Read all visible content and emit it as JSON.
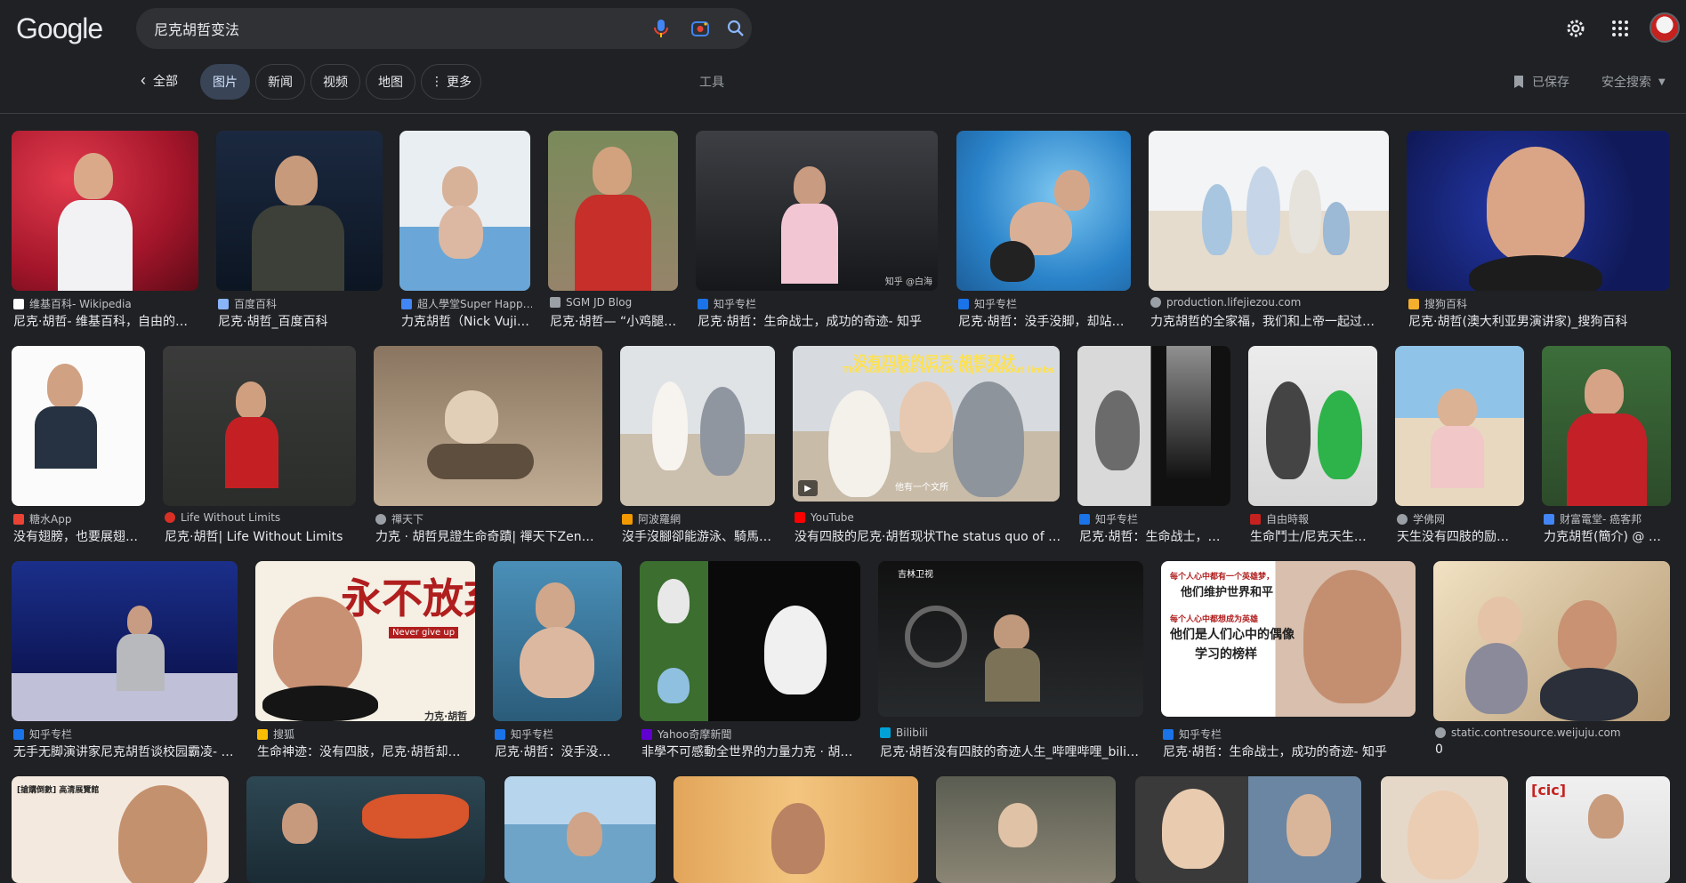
{
  "header": {
    "logo": "Google",
    "search_value": "尼克胡哲变法"
  },
  "nav": {
    "back_label": "全部",
    "chips": [
      "图片",
      "新闻",
      "视频",
      "地图",
      "更多"
    ],
    "tools": "工具",
    "saved": "已保存",
    "safe_search": "安全搜索"
  },
  "results": [
    {
      "source": "维基百科- Wikipedia",
      "title": "尼克·胡哲- 维基百科，自由的…"
    },
    {
      "source": "百度百科",
      "title": "尼克·胡哲_百度百科"
    },
    {
      "source": "超人學堂Super Happ…",
      "title": "力克胡哲（Nick Vuji…"
    },
    {
      "source": "SGM JD Blog",
      "title": "尼克·胡哲— “小鸡腿”…"
    },
    {
      "source": "知乎专栏",
      "title": "尼克·胡哲：生命战士，成功的奇迹- 知乎"
    },
    {
      "source": "知乎专栏",
      "title": "尼克·胡哲：没手没脚，却站…"
    },
    {
      "source": "production.lifejiezou.com",
      "title": "力克胡哲的全家福，我们和上帝一起过…"
    },
    {
      "source": "搜狗百科",
      "title": "尼克·胡哲(澳大利亚男演讲家)_搜狗百科"
    },
    {
      "source": "糖水App",
      "title": "没有翅膀，也要展翅…"
    },
    {
      "source": "Life Without Limits",
      "title": "尼克·胡哲| Life Without Limits"
    },
    {
      "source": "禪天下",
      "title": "力克 · 胡哲見證生命奇蹟| 禪天下Zen…"
    },
    {
      "source": "阿波羅網",
      "title": "沒手沒腳卻能游泳、騎馬…"
    },
    {
      "source": "YouTube",
      "title": "没有四肢的尼克·胡哲现状The status quo of …"
    },
    {
      "source": "知乎专栏",
      "title": "尼克·胡哲：生命战士，…"
    },
    {
      "source": "自由時報",
      "title": "生命鬥士/尼克天生…"
    },
    {
      "source": "学佛网",
      "title": "天生没有四肢的励…"
    },
    {
      "source": "财富電堂- 癌客邦",
      "title": "力克胡哲(簡介) @ …"
    },
    {
      "source": "知乎专栏",
      "title": "无手无脚演讲家尼克胡哲谈校园霸凌- …"
    },
    {
      "source": "搜狐",
      "title": "生命神迹：没有四肢，尼克·胡哲却…"
    },
    {
      "source": "知乎专栏",
      "title": "尼克·胡哲：没手没…"
    },
    {
      "source": "Yahoo奇摩新聞",
      "title": "非學不可感動全世界的力量力克 · 胡…"
    },
    {
      "source": "Bilibili",
      "title": "尼克·胡哲没有四肢的奇迹人生_哔哩哔哩_bili…"
    },
    {
      "source": "知乎专栏",
      "title": "尼克·胡哲：生命战士，成功的奇迹- 知乎"
    },
    {
      "source": "static.contresource.weijuju.com",
      "title": "0"
    }
  ],
  "overlays": {
    "yt_title_cn": "没有四肢的尼克·胡哲现状",
    "yt_title_en": "The status quo of Nick Vujic without limbs",
    "yt_sub": "他有一个文所",
    "zhihu_wm": "知乎 @白海",
    "poster_big": "永不放弃",
    "poster_en": "Never give up",
    "poster_name": "力克·胡哲",
    "quote_l1": "每个人心中都有一个英雄梦，",
    "quote_l2": "他们维护世界和平",
    "quote_l3": "每个人心中都想成为英雄",
    "quote_l4": "他们是人们心中的偶像",
    "quote_l5": "学习的榜样",
    "tv_logo": "吉林卫视",
    "news_badge": "[搶購倒數] 高清展覽館",
    "bracket": "[cic]"
  },
  "colors": {
    "background": "#202124",
    "chip_active": "#394457",
    "search_bg": "#303134"
  }
}
